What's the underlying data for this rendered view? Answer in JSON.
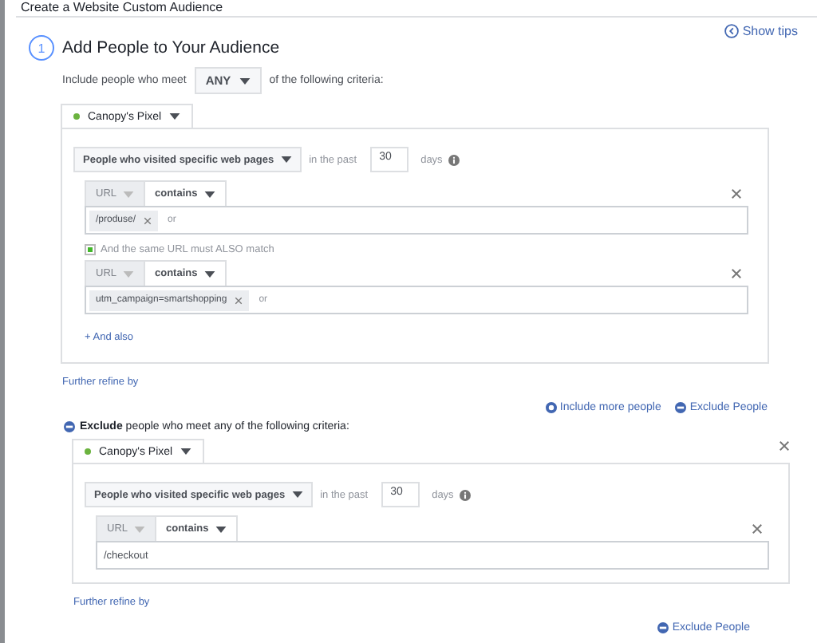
{
  "dialog_title": "Create a Website Custom Audience",
  "step": {
    "number": "1",
    "title": "Add People to Your Audience"
  },
  "show_tips": "Show tips",
  "include": {
    "prefix": "Include people who meet",
    "match": "ANY",
    "suffix": "of the following criteria:"
  },
  "include_block": {
    "pixel": "Canopy's Pixel",
    "closable": false,
    "rule": {
      "event": "People who visited specific web pages",
      "in_the_past": "in the past",
      "days": "30",
      "days_label": "days"
    },
    "conditions": [
      {
        "field": "URL",
        "operator": "contains",
        "kind": "tags",
        "tags": [
          "/produse/"
        ],
        "or_hint": "or"
      },
      {
        "also_match": {
          "label": "And the same URL must ALSO match",
          "checked": true
        },
        "field": "URL",
        "operator": "contains",
        "kind": "tags",
        "tags": [
          "utm_campaign=smartshopping"
        ],
        "or_hint": "or"
      }
    ],
    "and_also": "+ And also"
  },
  "further_refine_include": "Further refine by",
  "actions": [
    "Include more people",
    "Exclude People"
  ],
  "exclude_heading": "**Exclude** people who meet any of the following criteria:",
  "exclude_block": {
    "pixel": "Canopy's Pixel",
    "closable": true,
    "rule": {
      "event": "People who visited specific web pages",
      "in_the_past": "in the past",
      "days": "30",
      "days_label": "days"
    },
    "conditions": [
      {
        "field": "URL",
        "operator": "contains",
        "kind": "text",
        "value": "/checkout"
      }
    ]
  },
  "further_refine_exclude": "Further refine by",
  "footer_action": "Exclude People"
}
